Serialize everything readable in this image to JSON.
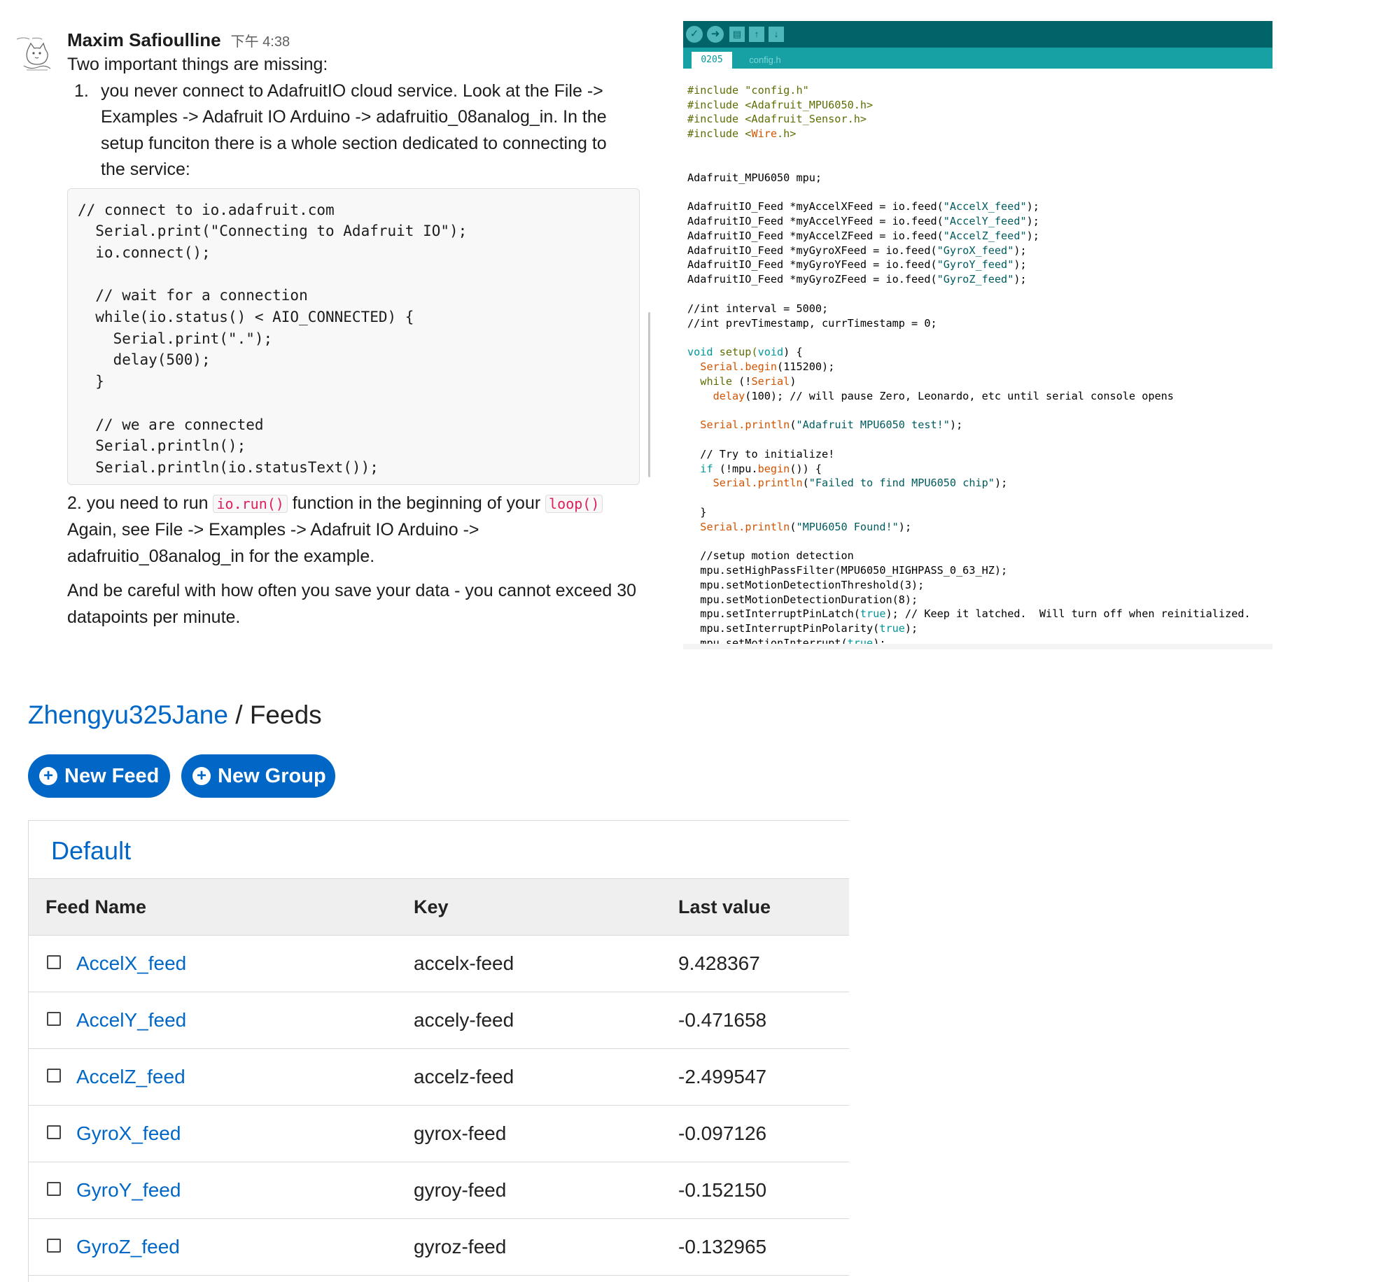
{
  "message": {
    "sender": "Maxim Safioulline",
    "time": "下午 4:38",
    "intro": "Two important things are missing:",
    "item1_num": "1.",
    "item1_text": "you never connect to AdafruitIO cloud service. Look at the File -> Examples -> Adafruit IO Arduino -> adafruitio_08analog_in. In the setup funciton there is a whole section dedicated to connecting to the service:",
    "code": "// connect to io.adafruit.com\n  Serial.print(\"Connecting to Adafruit IO\");\n  io.connect();\n\n  // wait for a connection\n  while(io.status() < AIO_CONNECTED) {\n    Serial.print(\".\");\n    delay(500);\n  }\n\n  // we are connected\n  Serial.println();\n  Serial.println(io.statusText());",
    "item2_prefix": "2.  you need to run ",
    "item2_code1": "io.run()",
    "item2_mid": " function in the beginning of your ",
    "item2_code2": "loop()",
    "item2_rest": "Again, see File -> Examples -> Adafruit IO Arduino -> adafruitio_08analog_in for the example.",
    "closing": "And be careful with how often you save your data - you cannot exceed 30 datapoints per minute."
  },
  "ide": {
    "tabs": [
      "0205",
      "config.h"
    ],
    "code": {
      "inc1": "#include \"config.h\"",
      "inc2": "#include <Adafruit_MPU6050.h>",
      "inc3": "#include <Adafruit_Sensor.h>",
      "inc4_a": "#include <",
      "inc4_b": "Wire",
      "inc4_c": ".h>",
      "mpu": "Adafruit_MPU6050 mpu;",
      "feeds": [
        {
          "decl": "AdafruitIO_Feed *myAccelXFeed = io.feed(",
          "str": "\"AccelX_feed\"",
          "end": ");"
        },
        {
          "decl": "AdafruitIO_Feed *myAccelYFeed = io.feed(",
          "str": "\"AccelY_feed\"",
          "end": ");"
        },
        {
          "decl": "AdafruitIO_Feed *myAccelZFeed = io.feed(",
          "str": "\"AccelZ_feed\"",
          "end": ");"
        },
        {
          "decl": "AdafruitIO_Feed *myGyroXFeed = io.feed(",
          "str": "\"GyroX_feed\"",
          "end": ");"
        },
        {
          "decl": "AdafruitIO_Feed *myGyroYFeed = io.feed(",
          "str": "\"GyroY_feed\"",
          "end": ");"
        },
        {
          "decl": "AdafruitIO_Feed *myGyroZFeed = io.feed(",
          "str": "\"GyroZ_feed\"",
          "end": ");"
        }
      ],
      "c1": "//int interval = 5000;",
      "c2": "//int prevTimestamp, currTimestamp = 0;",
      "setup_a": "void",
      "setup_b": " setup(",
      "setup_c": "void",
      "setup_d": ") {",
      "begin_a": "Serial",
      "begin_b": ".begin",
      "begin_c": "(115200);",
      "while_a": "while",
      "while_b": " (!",
      "while_c": "Serial",
      "while_d": ")",
      "delay_a": "delay",
      "delay_b": "(100); // will pause Zero, Leonardo, etc until serial console opens",
      "println1_a": "Serial",
      "println1_b": ".println",
      "println1_c": "(",
      "println1_d": "\"Adafruit MPU6050 test!\"",
      "println1_e": ");",
      "try_comment": "// Try to initialize!",
      "if_a": "if",
      "if_b": " (!mpu.",
      "if_c": "begin",
      "if_d": "()) {",
      "fail_a": "Serial",
      "fail_b": ".println",
      "fail_c": "(",
      "fail_d": "\"Failed to find MPU6050 chip\"",
      "fail_e": ");",
      "close_brace": "}",
      "found_a": "Serial",
      "found_b": ".println",
      "found_c": "(",
      "found_d": "\"MPU6050 Found!\"",
      "found_e": ");",
      "motion_comment": "//setup motion detection",
      "m1": "mpu.setHighPassFilter(MPU6050_HIGHPASS_0_63_HZ);",
      "m2": "mpu.setMotionDetectionThreshold(3);",
      "m3": "mpu.setMotionDetectionDuration(8);",
      "m4_a": "mpu.setInterruptPinLatch(",
      "m4_b": "true",
      "m4_c": "); // Keep it latched.  Will turn off when reinitialized.",
      "m5_a": "mpu.setInterruptPinPolarity(",
      "m5_b": "true",
      "m5_c": ");",
      "m6_a": "mpu.setMotionInterrupt(",
      "m6_b": "true",
      "m6_c": ");"
    }
  },
  "feeds_page": {
    "user": "Zhengyu325Jane",
    "separator": " / ",
    "title": "Feeds",
    "new_feed_label": "New Feed",
    "new_group_label": "New Group",
    "group_name": "Default",
    "columns": [
      "Feed Name",
      "Key",
      "Last value"
    ],
    "rows": [
      {
        "name": "AccelX_feed",
        "key": "accelx-feed",
        "value": "9.428367"
      },
      {
        "name": "AccelY_feed",
        "key": "accely-feed",
        "value": "-0.471658"
      },
      {
        "name": "AccelZ_feed",
        "key": "accelz-feed",
        "value": "-2.499547"
      },
      {
        "name": "GyroX_feed",
        "key": "gyrox-feed",
        "value": "-0.097126"
      },
      {
        "name": "GyroY_feed",
        "key": "gyroy-feed",
        "value": "-0.152150"
      },
      {
        "name": "GyroZ_feed",
        "key": "gyroz-feed",
        "value": "-0.132965"
      }
    ]
  },
  "colors": {
    "link_blue": "#0067c7",
    "ide_teal": "#006468",
    "ide_tab_teal": "#17a1a5",
    "slack_code_red": "#e01e5a"
  },
  "icons": [
    "avatar-cat-sketch",
    "verify-icon",
    "upload-icon",
    "new-icon",
    "open-icon",
    "save-icon",
    "plus-circle-icon",
    "checkbox-icon"
  ]
}
